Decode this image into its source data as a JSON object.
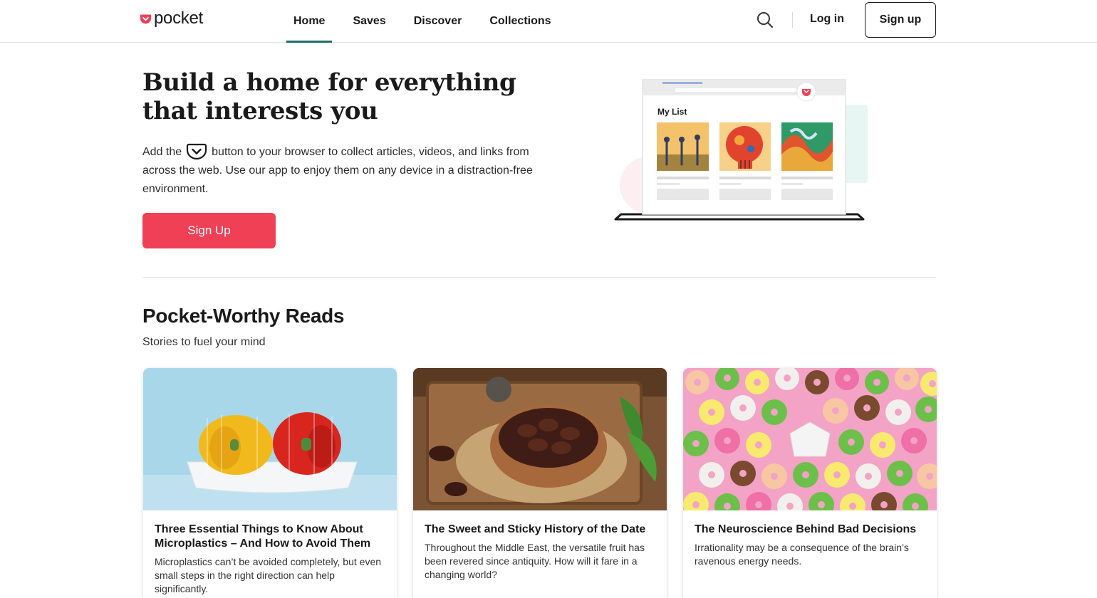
{
  "header": {
    "logo_text": "pocket",
    "nav": [
      {
        "label": "Home",
        "active": true
      },
      {
        "label": "Saves",
        "active": false
      },
      {
        "label": "Discover",
        "active": false
      },
      {
        "label": "Collections",
        "active": false
      }
    ],
    "search_icon": "search-icon",
    "login_label": "Log in",
    "signup_label": "Sign up"
  },
  "hero": {
    "title": "Build a home for everything that interests you",
    "text_before_icon": "Add the",
    "text_after_icon": "button to your browser to collect articles, videos, and links from across the web. Use our app to enjoy them on any device in a distraction-free environment.",
    "cta_label": "Sign Up",
    "illustration": {
      "list_title": "My List"
    }
  },
  "reads": {
    "title": "Pocket-Worthy Reads",
    "subtitle": "Stories to fuel your mind",
    "cards": [
      {
        "title": "Three Essential Things to Know About Microplastics – And How to Avoid Them",
        "description": "Microplastics can’t be avoided completely, but even small steps in the right direction can help significantly."
      },
      {
        "title": "The Sweet and Sticky History of the Date",
        "description": "Throughout the Middle East, the versatile fruit has been revered since antiquity. How will it fare in a changing world?"
      },
      {
        "title": "The Neuroscience Behind Bad Decisions",
        "description": "Irrationality may be a consequence of the brain’s ravenous energy needs."
      }
    ]
  },
  "colors": {
    "brand": "#ef4056",
    "nav_active": "#1e6b6b",
    "text": "#1a1a1a"
  }
}
